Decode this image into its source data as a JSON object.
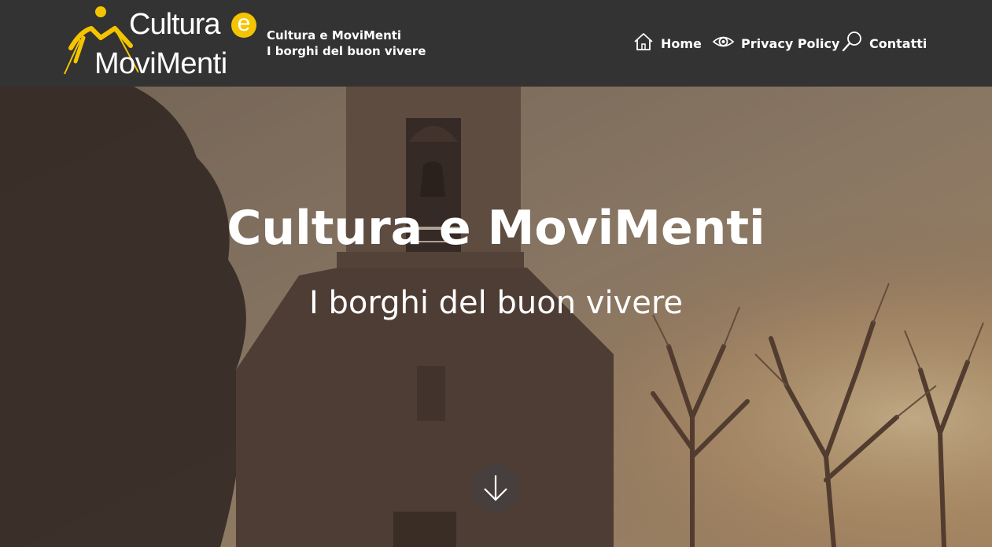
{
  "header": {
    "logo": {
      "line1": "Cultura",
      "e": "e",
      "line2": "MoviMenti"
    },
    "tagline": {
      "line1": "Cultura e MoviMenti",
      "line2": "I borghi del buon vivere"
    },
    "nav": [
      {
        "label": "Home",
        "icon": "home-icon"
      },
      {
        "label": "Privacy Policy",
        "icon": "eye-icon"
      },
      {
        "label": "Contatti",
        "icon": "search-icon"
      }
    ]
  },
  "hero": {
    "title": "Cultura e MoviMenti",
    "subtitle": "I borghi del buon vivere",
    "scroll_icon": "arrow-down-icon"
  },
  "colors": {
    "header_bg": "#333333",
    "accent": "#f5c400",
    "text": "#ffffff"
  }
}
